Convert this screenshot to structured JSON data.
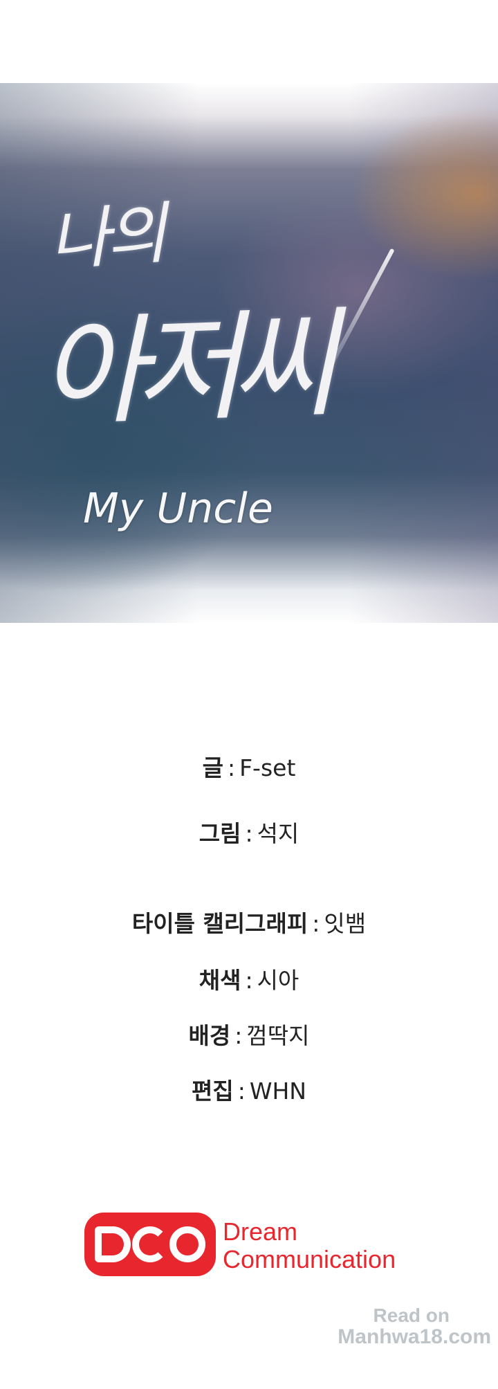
{
  "title": {
    "korean_line1": "나의",
    "korean_line2": "아저씨",
    "english": "My Uncle"
  },
  "credits": [
    {
      "role": "글",
      "separator": ":",
      "name": "F-set"
    },
    {
      "role": "그림",
      "separator": ":",
      "name": "석지"
    },
    {
      "role": "타이틀 캘리그래피",
      "separator": ":",
      "name": "잇뱀"
    },
    {
      "role": "채색",
      "separator": ":",
      "name": "시아"
    },
    {
      "role": "배경",
      "separator": ":",
      "name": "껌딱지"
    },
    {
      "role": "편집",
      "separator": ":",
      "name": "WHN"
    }
  ],
  "publisher": {
    "logo_text": "DCC",
    "name_line1": "Dream",
    "name_line2": "Communication",
    "brand_color": "#e8262d"
  },
  "watermark": {
    "line1": "Read on",
    "line2": "Manhwa18.com"
  }
}
